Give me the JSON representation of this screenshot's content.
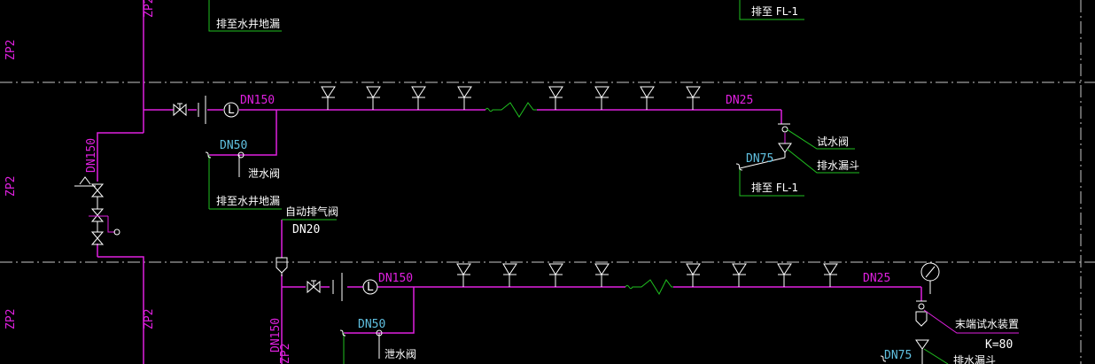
{
  "labels": {
    "riser_label": "ZP2",
    "riser_pipe": "DN150",
    "main_pipe_size": "DN150",
    "end_pipe_size": "DN25",
    "branch_pipe_size": "DN50",
    "drain_pipe_size": "DN75",
    "vent_pipe_size": "DN20",
    "relief_valve": "泄水阀",
    "drain_to_sump": "排至水井地漏",
    "drain_to_fl": "排至 FL-1",
    "test_valve": "试水阀",
    "drain_funnel": "排水漏斗",
    "auto_air_vent": "自动排气阀",
    "end_test_device": "末端试水装置",
    "k_factor": "K=80"
  },
  "colors": {
    "pipe": "#e020e0",
    "annotation": "#ffffff",
    "leader": "#20c020",
    "sprinkler": "#ffffff",
    "dn_cyan": "#60c0e0",
    "axis": "#c8c8c8"
  }
}
